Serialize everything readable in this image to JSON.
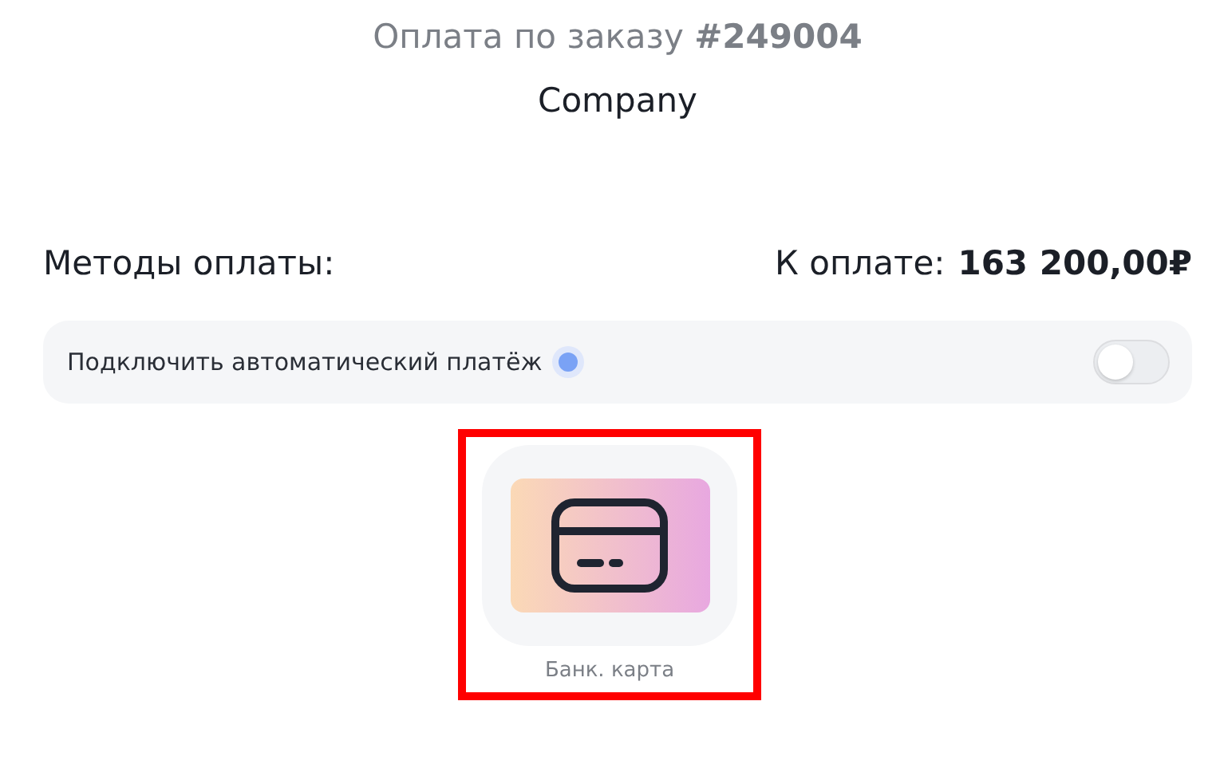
{
  "header": {
    "title": "Оплата по заказу **#249004**",
    "company": "Company"
  },
  "methods_heading": "Методы оплаты:",
  "amount": {
    "label": "К оплате:",
    "value": "163 200,00₽"
  },
  "autopay": {
    "label": "Подключить автоматический платёж",
    "on": false
  },
  "methods": [
    {
      "label": "Банк. карта",
      "selected": true
    }
  ]
}
